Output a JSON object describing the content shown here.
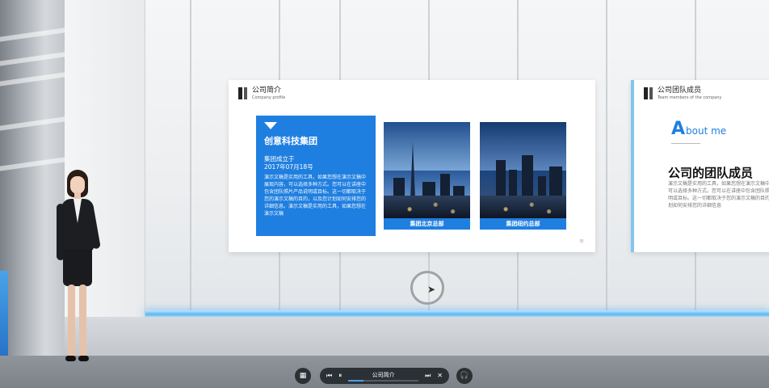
{
  "slides": {
    "company_profile": {
      "title": "公司简介",
      "subtitle": "Company profile",
      "card": {
        "title": "创意科技集团",
        "founded_label": "集团成立于",
        "founded_date": "2017年07月18号",
        "body": "演示文稿是实用的工具，如果您想在演示文稿中展现内容，可以选择多种方式。您可以在讲座中包含团队照片产品说明或目标。这一切都取决于您的演示文稿的目的，以及您计划如何安排您的详细信息。演示文稿是实用的工具，如果您想在演示文稿"
      },
      "photos": [
        {
          "caption": "集团北京总部"
        },
        {
          "caption": "集团纽约总部"
        }
      ]
    },
    "team_members": {
      "title": "公司团队成员",
      "subtitle": "Team members of the company",
      "about_initial": "A",
      "about_rest": "bout me",
      "heading": "公司的团队成员",
      "body": "演示文稿是实用的工具，如果您想在演示文稿中展现内容，可以选择多种方式。您可以在讲座中包含团队照片，产品说明或目标。这一切都取决于您的演示文稿的目的，以及您计划如何安排您的详细信息"
    }
  },
  "player": {
    "prev_icon": "⏮",
    "pause_icon": "⏸",
    "track_title": "公司简介",
    "next_icon": "⏭",
    "close_icon": "✕",
    "progress": 0.22
  },
  "controls": {
    "grid_icon": "▦",
    "audio_icon": "🎧"
  },
  "colors": {
    "accent": "#1f7fe0",
    "light_strip": "#5fb7f2",
    "control_bg": "#2b3035"
  }
}
